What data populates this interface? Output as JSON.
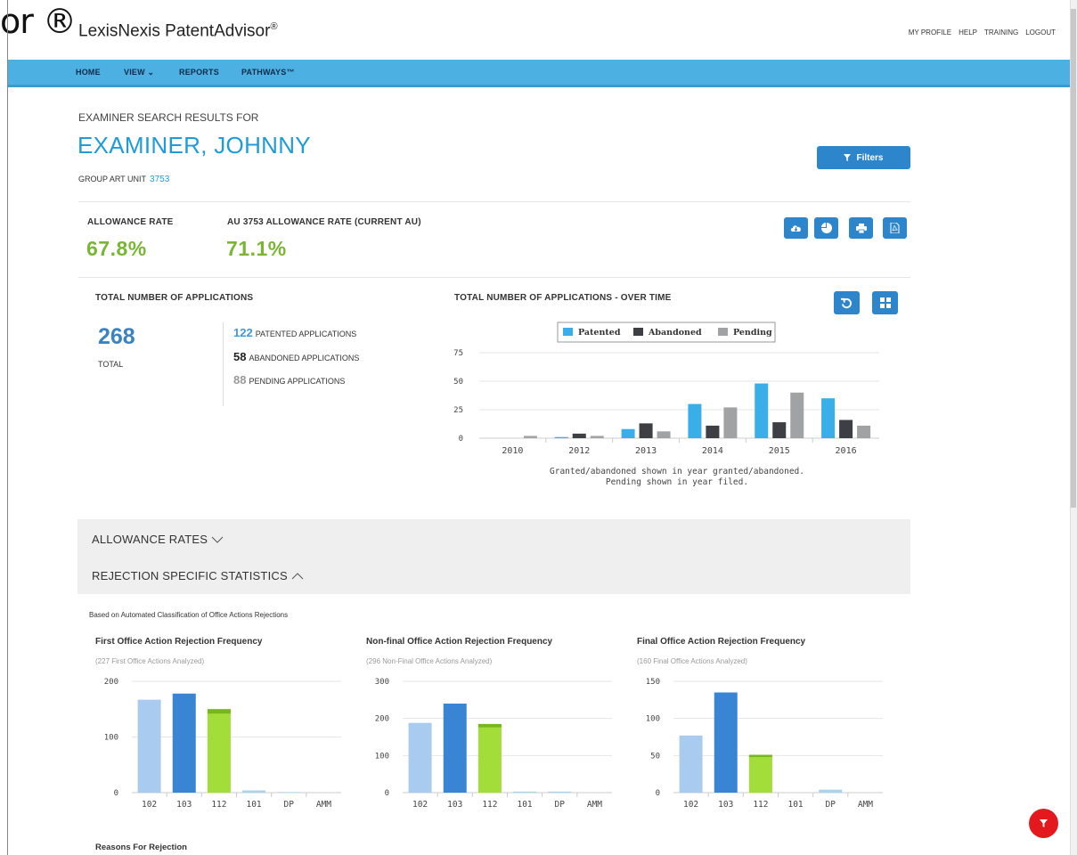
{
  "header": {
    "overlay_text": "or ®",
    "brand": "LexisNexis PatentAdvisor",
    "brand_mark": "®",
    "util_links": [
      "MY PROFILE",
      "HELP",
      "TRAINING",
      "LOGOUT"
    ]
  },
  "nav": {
    "items": [
      "HOME",
      "VIEW ⌄",
      "REPORTS",
      "PATHWAYS™"
    ]
  },
  "examiner": {
    "search_label": "EXAMINER SEARCH RESULTS FOR",
    "name": "EXAMINER, JOHNNY",
    "group_art_unit_label": "GROUP ART UNIT",
    "group_art_unit_value": "3753",
    "filters_label": "Filters"
  },
  "kpis": {
    "allowance_rate_label": "ALLOWANCE RATE",
    "allowance_rate_value": "67.8%",
    "au_rate_label": "AU 3753 ALLOWANCE RATE (CURRENT AU)",
    "au_rate_value": "71.1%"
  },
  "toolbar_icons": [
    "download-icon",
    "pie-chart-icon",
    "print-icon",
    "pdf-icon"
  ],
  "chart_icons": [
    "reset-icon",
    "grid-icon"
  ],
  "totals": {
    "title": "TOTAL NUMBER OF APPLICATIONS",
    "total_value": "268",
    "total_label": "TOTAL",
    "patented_num": "122",
    "patented_label": "PATENTED APPLICATIONS",
    "abandoned_num": "58",
    "abandoned_label": "ABANDONED APPLICATIONS",
    "pending_num": "88",
    "pending_label": "PENDING APPLICATIONS"
  },
  "over_time": {
    "title": "TOTAL NUMBER OF APPLICATIONS - OVER TIME",
    "note_line1": "Granted/abandoned shown in year granted/abandoned.",
    "note_line2": "Pending shown in year filed."
  },
  "accordions": {
    "allowance_rates": "ALLOWANCE RATES",
    "rejection_stats": "REJECTION SPECIFIC STATISTICS"
  },
  "rejections": {
    "based_on": "Based on Automated Classification of Office Actions Rejections",
    "first_title": "First Office Action Rejection Frequency",
    "first_sub": "(227 First Office Actions Analyzed)",
    "nonfinal_title": "Non-final Office Action Rejection Frequency",
    "nonfinal_sub": "(296 Non-Final Office Actions Analyzed)",
    "final_title": "Final Office Action Rejection Frequency",
    "final_sub": "(160 Final Office Actions Analyzed)",
    "reasons_title": "Reasons For Rejection"
  },
  "colors": {
    "patented": "#3aaee8",
    "abandoned": "#3d3f44",
    "pending": "#a0a2a4",
    "r102": "#a9cbef",
    "r103": "#3a84d4",
    "r112": "#a3dd3a",
    "r112_top": "#76b719",
    "r_small": "#a9d3ef"
  },
  "chart_data": [
    {
      "type": "bar",
      "title": "TOTAL NUMBER OF APPLICATIONS - OVER TIME",
      "categories": [
        "2010",
        "2012",
        "2013",
        "2014",
        "2015",
        "2016"
      ],
      "series": [
        {
          "name": "Patented",
          "values": [
            0,
            1,
            8,
            30,
            48,
            35
          ]
        },
        {
          "name": "Abandoned",
          "values": [
            0,
            4,
            13,
            11,
            14,
            16
          ]
        },
        {
          "name": "Pending",
          "values": [
            2,
            2,
            6,
            27,
            40,
            11
          ]
        }
      ],
      "ylim": [
        0,
        75
      ],
      "yticks": [
        0,
        25,
        50,
        75
      ],
      "legend": "top"
    },
    {
      "type": "bar",
      "title": "First Office Action Rejection Frequency",
      "categories": [
        "102",
        "103",
        "112",
        "101",
        "DP",
        "AMM"
      ],
      "values": [
        167,
        178,
        150,
        4,
        1,
        0
      ],
      "ylim": [
        0,
        200
      ],
      "yticks": [
        0,
        100,
        200
      ]
    },
    {
      "type": "bar",
      "title": "Non-final Office Action Rejection Frequency",
      "categories": [
        "102",
        "103",
        "112",
        "101",
        "DP",
        "AMM"
      ],
      "values": [
        188,
        240,
        185,
        3,
        3,
        0
      ],
      "ylim": [
        0,
        300
      ],
      "yticks": [
        0,
        100,
        200,
        300
      ]
    },
    {
      "type": "bar",
      "title": "Final Office Action Rejection Frequency",
      "categories": [
        "102",
        "103",
        "112",
        "101",
        "DP",
        "AMM"
      ],
      "values": [
        77,
        135,
        51,
        0,
        4,
        0
      ],
      "ylim": [
        0,
        150
      ],
      "yticks": [
        0,
        50,
        100,
        150
      ]
    }
  ]
}
